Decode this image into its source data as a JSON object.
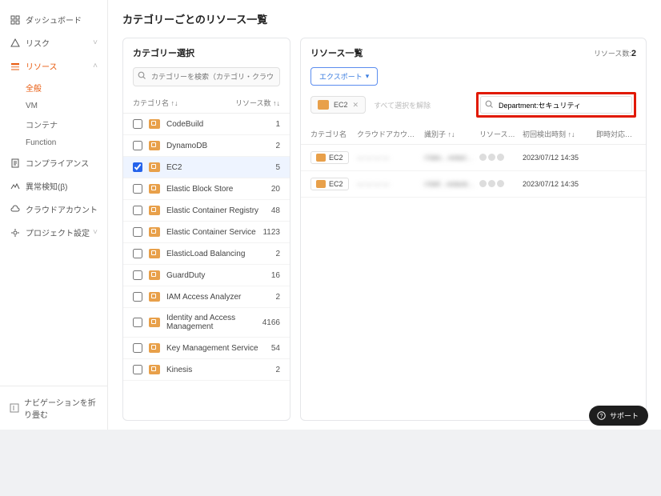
{
  "sidebar": {
    "items": [
      {
        "label": "ダッシュボード",
        "icon": "dashboard",
        "expandable": false
      },
      {
        "label": "リスク",
        "icon": "risk",
        "expandable": true
      },
      {
        "label": "リソース",
        "icon": "resource",
        "expandable": true,
        "active": true,
        "children": [
          {
            "label": "全般",
            "active": true
          },
          {
            "label": "VM"
          },
          {
            "label": "コンテナ"
          },
          {
            "label": "Function"
          }
        ]
      },
      {
        "label": "コンプライアンス",
        "icon": "compliance",
        "expandable": false
      },
      {
        "label": "異常検知(β)",
        "icon": "anomaly",
        "expandable": false
      },
      {
        "label": "クラウドアカウント",
        "icon": "cloud",
        "expandable": false
      },
      {
        "label": "プロジェクト設定",
        "icon": "settings",
        "expandable": true
      }
    ],
    "collapse_label": "ナビゲーションを折り畳む"
  },
  "page_title": "カテゴリーごとのリソース一覧",
  "left_panel": {
    "title": "カテゴリー選択",
    "search_placeholder": "カテゴリーを検索（カテゴリ・クラウド名）",
    "header_name": "カテゴリ名 ↑↓",
    "header_count": "リソース数 ↑↓",
    "rows": [
      {
        "name": "CodeBuild",
        "count": 1
      },
      {
        "name": "DynamoDB",
        "count": 2
      },
      {
        "name": "EC2",
        "count": 5,
        "selected": true
      },
      {
        "name": "Elastic Block Store",
        "count": 20
      },
      {
        "name": "Elastic Container Registry",
        "count": 48
      },
      {
        "name": "Elastic Container Service",
        "count": 1123
      },
      {
        "name": "ElasticLoad Balancing",
        "count": 2
      },
      {
        "name": "GuardDuty",
        "count": 16
      },
      {
        "name": "IAM Access Analyzer",
        "count": 2
      },
      {
        "name": "Identity and Access Management",
        "count": 4166
      },
      {
        "name": "Key Management Service",
        "count": 54
      },
      {
        "name": "Kinesis",
        "count": 2
      }
    ]
  },
  "right_panel": {
    "title": "リソース一覧",
    "count_label": "リソース数:",
    "count_value": "2",
    "export_label": "エクスポート",
    "chip_label": "EC2",
    "clear_label": "すべて選択を解除",
    "search_value": "Department:セキュリティ",
    "columns": {
      "category": "カテゴリ名",
      "account": "クラウドアカウント",
      "identifier": "識別子 ↑↓",
      "attrs": "リソース属性",
      "first_detect": "初回検出時刻 ↑↓",
      "last": "即時対応リス"
    },
    "rows": [
      {
        "category": "EC2",
        "account": "— — — —",
        "identifier": "i-0abc…redacted…",
        "first_detect": "2023/07/12 14:35"
      },
      {
        "category": "EC2",
        "account": "— — — —",
        "identifier": "i-0def…redacted…",
        "first_detect": "2023/07/12 14:35"
      }
    ]
  },
  "support_label": "サポート"
}
